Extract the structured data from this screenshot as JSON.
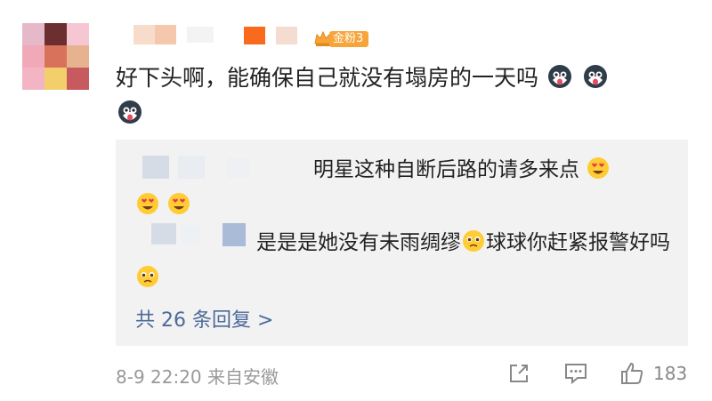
{
  "comment": {
    "fan_badge": "金粉3",
    "text": "好下头啊，能确保自己就没有塌房的一天吗",
    "emoji_name": "husky-dog-emoji",
    "time": "8-9 22:20",
    "source": "来自安徽",
    "like_count": "183"
  },
  "replies": [
    {
      "text": "明星这种自断后路的请多来点",
      "emoji_name": "heart-eyes-emoji"
    },
    {
      "text_a": "是是是她没有未雨绸缪",
      "text_b": "球球你赶紧报警好吗",
      "emoji_name": "pleading-face-emoji"
    }
  ],
  "more_replies_label": "共 26 条回复 >",
  "colors": {
    "link": "#4d6a9a",
    "muted": "#999999",
    "reply_bg": "#f2f2f2",
    "badge": "#f7a43a"
  }
}
